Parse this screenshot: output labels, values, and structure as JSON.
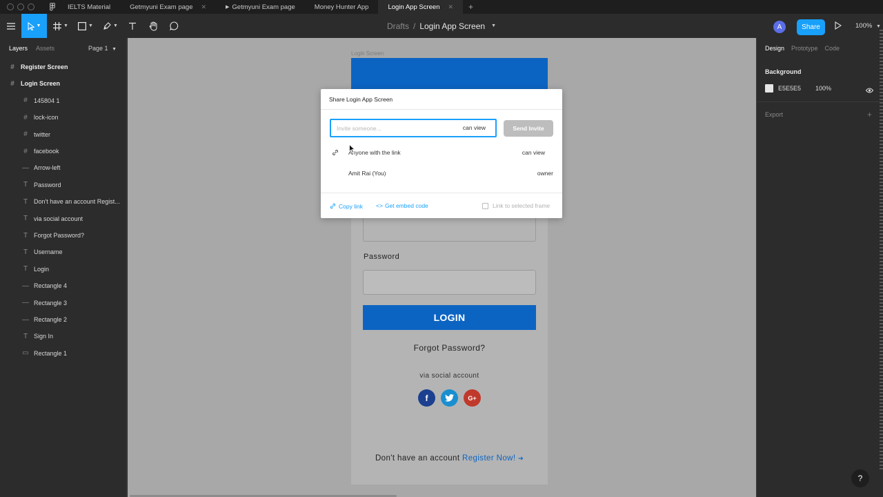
{
  "tabs": [
    {
      "label": "IELTS Material",
      "active": false,
      "play": false
    },
    {
      "label": "Getmyuni Exam page",
      "active": false,
      "play": false
    },
    {
      "label": "Getmyuni Exam page",
      "active": false,
      "play": true
    },
    {
      "label": "Money Hunter App",
      "active": false,
      "play": false
    },
    {
      "label": "Login App Screen",
      "active": true,
      "play": false
    }
  ],
  "toolbar": {
    "breadcrumb_parent": "Drafts",
    "breadcrumb_separator": "/",
    "breadcrumb_current": "Login App Screen",
    "avatar_initial": "A",
    "share_label": "Share",
    "zoom": "100%"
  },
  "left_panel": {
    "tab_layers": "Layers",
    "tab_assets": "Assets",
    "page": "Page 1",
    "layers": [
      {
        "label": "Register Screen",
        "icon": "frame",
        "top": true
      },
      {
        "label": "Login Screen",
        "icon": "frame",
        "top": true
      },
      {
        "label": "145804 1",
        "icon": "frame",
        "top": false
      },
      {
        "label": "lock-icon",
        "icon": "frame",
        "top": false
      },
      {
        "label": "twitter",
        "icon": "frame",
        "top": false
      },
      {
        "label": "facebook",
        "icon": "frame",
        "top": false
      },
      {
        "label": "Arrow-left",
        "icon": "line",
        "top": false
      },
      {
        "label": "Password",
        "icon": "text",
        "top": false
      },
      {
        "label": "Don't have an account Regist...",
        "icon": "text",
        "top": false
      },
      {
        "label": "via social account",
        "icon": "text",
        "top": false
      },
      {
        "label": "Forgot Password?",
        "icon": "text",
        "top": false
      },
      {
        "label": "Username",
        "icon": "text",
        "top": false
      },
      {
        "label": "Login",
        "icon": "text",
        "top": false
      },
      {
        "label": "Rectangle 4",
        "icon": "line",
        "top": false
      },
      {
        "label": "Rectangle 3",
        "icon": "line",
        "top": false
      },
      {
        "label": "Rectangle 2",
        "icon": "line",
        "top": false
      },
      {
        "label": "Sign In",
        "icon": "text",
        "top": false
      },
      {
        "label": "Rectangle 1",
        "icon": "rect",
        "top": false
      }
    ]
  },
  "canvas": {
    "frame_label": "Login Screen",
    "password_label": "Password",
    "login_button": "LOGIN",
    "forgot": "Forgot Password?",
    "via_social": "via social account",
    "no_account": "Don't have an account",
    "register": "Register Now!",
    "brand_color": "#0c64c2"
  },
  "share_modal": {
    "title": "Share Login App Screen",
    "invite_placeholder": "Invite someone...",
    "invite_permission": "can view",
    "send_invite": "Send Invite",
    "anyone_label": "Anyone with the link",
    "anyone_permission": "can view",
    "owner_name": "Amit Rai (You)",
    "owner_role": "owner",
    "copy_link": "Copy link",
    "embed_code": "Get embed code",
    "link_to_frame": "Link to selected frame"
  },
  "right_panel": {
    "tab_design": "Design",
    "tab_prototype": "Prototype",
    "tab_code": "Code",
    "background_title": "Background",
    "background_hex": "E5E5E5",
    "background_opacity": "100%",
    "export_title": "Export"
  },
  "help_label": "?"
}
